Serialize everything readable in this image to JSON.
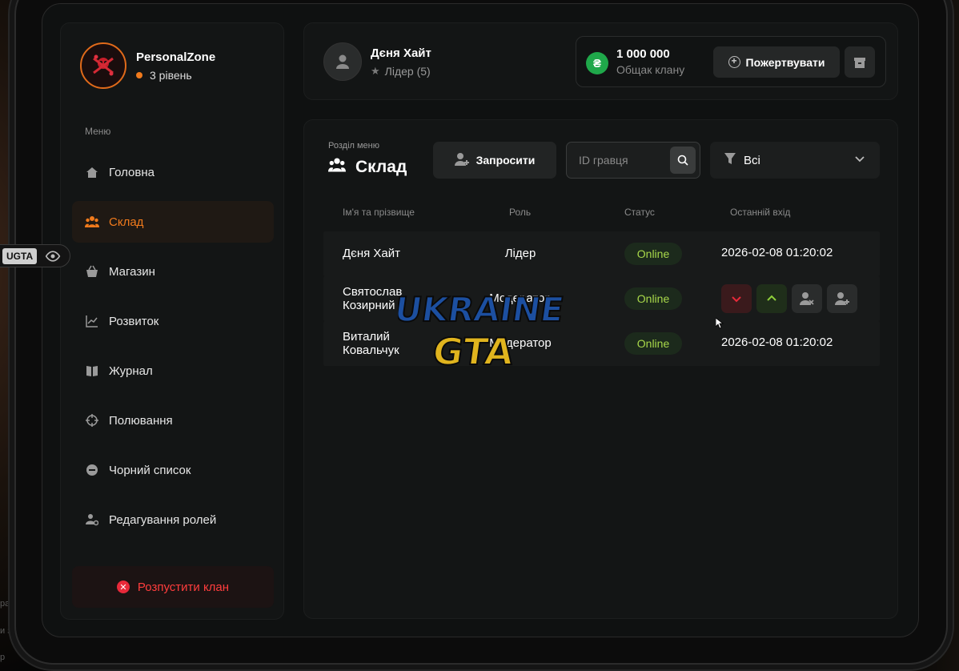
{
  "overlay": {
    "tag_label": "UGTA",
    "side_text_1": "ра",
    "side_text_2": "и з",
    "side_text_3": "р"
  },
  "profile": {
    "name": "PersonalZone",
    "level": "3 рівень"
  },
  "menu": {
    "title": "Меню",
    "items": [
      {
        "label": "Головна",
        "icon": "home-icon",
        "active": false
      },
      {
        "label": "Склад",
        "icon": "users-icon",
        "active": true
      },
      {
        "label": "Магазин",
        "icon": "basket-icon",
        "active": false
      },
      {
        "label": "Розвиток",
        "icon": "chart-icon",
        "active": false
      },
      {
        "label": "Журнал",
        "icon": "book-icon",
        "active": false
      },
      {
        "label": "Полювання",
        "icon": "crosshair-icon",
        "active": false
      },
      {
        "label": "Чорний список",
        "icon": "minus-circle-icon",
        "active": false
      },
      {
        "label": "Редагування ролей",
        "icon": "user-gear-icon",
        "active": false
      }
    ],
    "disband_label": "Розпустити клан"
  },
  "user": {
    "name": "Дєня Хайт",
    "role": "Лідер (5)"
  },
  "balance": {
    "currency_symbol": "₴",
    "amount": "1 000 000",
    "label": "Общак клану",
    "donate_label": "Пожертвувати"
  },
  "section": {
    "label": "Розділ меню",
    "title": "Склад",
    "invite_label": "Запросити",
    "id_placeholder": "ID гравця",
    "filter_value": "Всі"
  },
  "table": {
    "columns": [
      "Ім'я та прізвище",
      "Роль",
      "Статус",
      "Останній вхід"
    ],
    "rows": [
      {
        "name": "Дєня Хайт",
        "role": "Лідер",
        "status": "Online",
        "last_login": "2026-02-08 01:20:02"
      },
      {
        "name": "Святослав Козирний",
        "role": "Модератор",
        "status": "Online",
        "last_login": ""
      },
      {
        "name": "Виталий Ковальчук",
        "role": "Модератор",
        "status": "Online",
        "last_login": "2026-02-08 01:20:02"
      }
    ]
  },
  "watermark": {
    "line1": "UKRAINE",
    "line2": "GTA"
  },
  "colors": {
    "accent": "#f07a1c",
    "online": "#a8d84a",
    "danger": "#ff3d3d",
    "coin": "#1fa84a"
  }
}
